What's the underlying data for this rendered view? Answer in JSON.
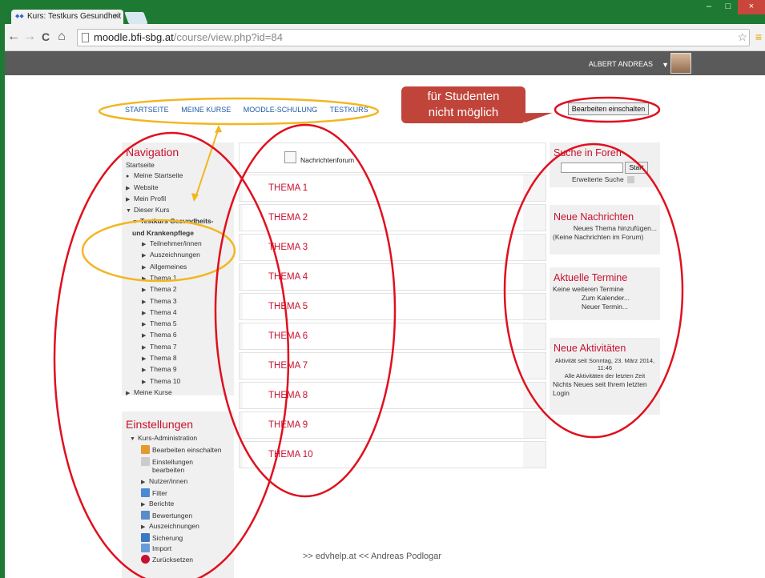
{
  "browser": {
    "tab_title": "Kurs: Testkurs Gesundheit",
    "tab_close": "×",
    "url_host": "moodle.bfi-sbg.at",
    "url_path": "/course/view.php?id=84",
    "back": "←",
    "forward": "→",
    "reload": "C",
    "home": "⌂",
    "star": "☆",
    "menu": "≡",
    "minimize": "–",
    "maximize": "□",
    "close": "×"
  },
  "header": {
    "user_name": "ALBERT ANDREAS",
    "user_caret": "▼"
  },
  "breadcrumb": [
    "STARTSEITE",
    "MEINE KURSE",
    "MOODLE-SCHULUNG",
    "TESTKURS"
  ],
  "edit_button": "Bearbeiten einschalten",
  "callout": {
    "line1": "für Studenten",
    "line2": "nicht möglich"
  },
  "navigation": {
    "title": "Navigation",
    "startseite": "Startseite",
    "meine_startseite": "Meine Startseite",
    "website": "Website",
    "mein_profil": "Mein Profil",
    "dieser_kurs": "Dieser Kurs",
    "course_line1": "Testkurs Gesundheits-",
    "course_line2": "und Krankenpflege",
    "course_items": [
      "Teilnehmer/innen",
      "Auszeichnungen",
      "Allgemeines",
      "Thema 1",
      "Thema 2",
      "Thema 3",
      "Thema 4",
      "Thema 5",
      "Thema 6",
      "Thema 7",
      "Thema 8",
      "Thema 9",
      "Thema 10"
    ],
    "meine_kurse": "Meine Kurse"
  },
  "settings": {
    "title": "Einstellungen",
    "kurs_admin": "Kurs-Administration",
    "items": [
      "Bearbeiten einschalten",
      "Einstellungen",
      "bearbeiten",
      "Nutzer/innen",
      "Filter",
      "Berichte",
      "Bewertungen",
      "Auszeichnungen",
      "Sicherung",
      "Import",
      "Zurücksetzen"
    ]
  },
  "forum": "Nachrichtenforum",
  "topics": [
    "THEMA 1",
    "THEMA 2",
    "THEMA 3",
    "THEMA 4",
    "THEMA 5",
    "THEMA 6",
    "THEMA 7",
    "THEMA 8",
    "THEMA 9",
    "THEMA 10"
  ],
  "search_forums": {
    "title": "Suche in Foren",
    "start": "Start",
    "advanced": "Erweiterte Suche"
  },
  "news": {
    "title": "Neue Nachrichten",
    "add": "Neues Thema hinzufügen...",
    "none": "(Keine Nachrichten im Forum)"
  },
  "events": {
    "title": "Aktuelle Termine",
    "none": "Keine weiteren Termine",
    "calendar": "Zum Kalender...",
    "new": "Neuer Termin..."
  },
  "activities": {
    "title": "Neue Aktivitäten",
    "since_line1": "Aktivität seit Sonntag, 23. März 2014,",
    "since_line2": "11:46",
    "all": "Alle Aktivitäten der letzten Zeit",
    "nothing_line1": "Nichts Neues seit Ihrem letzten",
    "nothing_line2": "Login"
  },
  "footer": ">> edvhelp.at <<  Andreas Podlogar",
  "colors": {
    "accent": "#c8102e",
    "annotation_red": "#e0101e",
    "annotation_yellow": "#f2b620"
  }
}
